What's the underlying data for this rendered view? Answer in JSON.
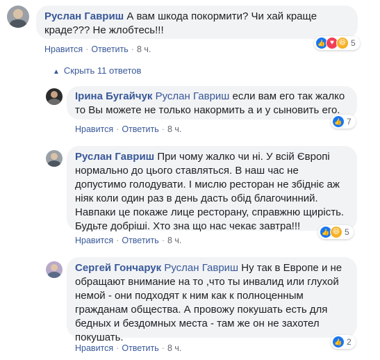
{
  "comments": [
    {
      "author": "Руслан Гавриш",
      "mention": "",
      "text": " А вам шкода покормити? Чи хай краще краде??? Не жлобтесь!!!",
      "actions": {
        "like": "Нравится",
        "reply": "Ответить",
        "time": "8 ч."
      },
      "reaction_count": "5",
      "reactions": [
        "like",
        "love",
        "haha"
      ]
    },
    {
      "author": "Ірина Бугайчук",
      "mention": "Руслан Гавриш",
      "text": " если вам его так жалко то Вы можете не только накормить а и у сыновить его.",
      "actions": {
        "like": "Нравится",
        "reply": "Ответить",
        "time": "8 ч."
      },
      "reaction_count": "7",
      "reactions": [
        "like"
      ]
    },
    {
      "author": "Руслан Гавриш",
      "mention": "",
      "text": " При чому жалко чи ні. У всій Європі нормально до цього ставляться. В наш час не допустимо голодувати. І мислю ресторан не збідніє аж ніяк коли один раз в день дасть обід благочинний. Навпаки це покаже лице ресторану, справжню щирість. Будьте добріші. Хто зна що нас чекає завтра!!!",
      "actions": {
        "like": "Нравится",
        "reply": "Ответить",
        "time": "8 ч."
      },
      "reaction_count": "5",
      "reactions": [
        "like",
        "haha"
      ]
    },
    {
      "author": "Сергей Гончарук",
      "mention": "Руслан Гавриш",
      "text": " Ну так в Европе и не обращают внимание на то ,что ты инвалид или глухой немой - они подходят к ним как к полноценным гражданам общества. А провожу покушать есть для бедных и бездомных места - там же он не захотел покушать.",
      "actions": {
        "like": "Нравится",
        "reply": "Ответить",
        "time": "8 ч."
      },
      "reaction_count": "2",
      "reactions": [
        "like"
      ]
    }
  ],
  "hide_replies": {
    "arrow": "▲",
    "label": "Скрыть 11 ответов"
  },
  "separator": "·",
  "icons": {
    "like": "👍",
    "love": "♥",
    "haha": "😆"
  },
  "colors": {
    "link": "#385898",
    "bubble": "#f2f3f5",
    "meta": "#606770"
  }
}
